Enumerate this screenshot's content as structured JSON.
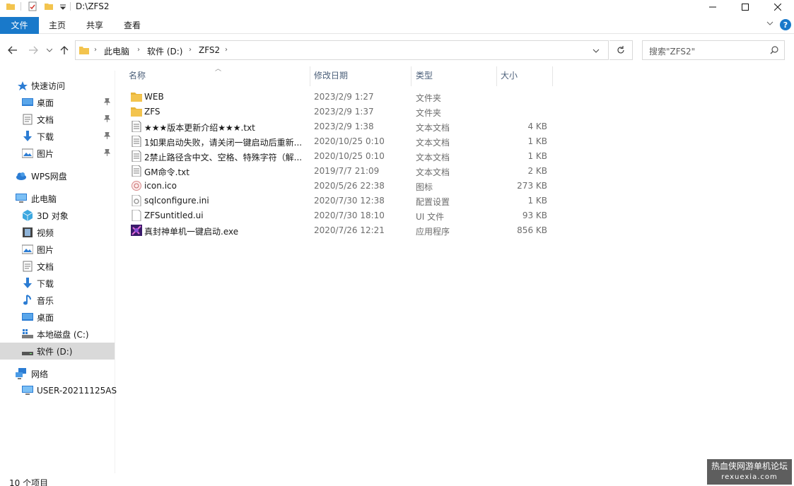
{
  "window": {
    "title": "D:\\ZFS2"
  },
  "ribbon": {
    "tabs": [
      "文件",
      "主页",
      "共享",
      "查看"
    ]
  },
  "address": {
    "parts": [
      "此电脑",
      "软件 (D:)",
      "ZFS2"
    ],
    "search_placeholder": "搜索\"ZFS2\""
  },
  "sidebar": {
    "items": [
      {
        "label": "快速访问",
        "icon": "star-icon",
        "level": 0
      },
      {
        "label": "桌面",
        "icon": "desktop-icon",
        "level": 1,
        "pinned": true
      },
      {
        "label": "文档",
        "icon": "document-icon",
        "level": 1,
        "pinned": true
      },
      {
        "label": "下载",
        "icon": "download-icon",
        "level": 1,
        "pinned": true
      },
      {
        "label": "图片",
        "icon": "picture-icon",
        "level": 1,
        "pinned": true
      },
      {
        "label": "WPS网盘",
        "icon": "cloud-icon",
        "level": 0
      },
      {
        "label": "此电脑",
        "icon": "computer-icon",
        "level": 0
      },
      {
        "label": "3D 对象",
        "icon": "3d-objects-icon",
        "level": 1
      },
      {
        "label": "视频",
        "icon": "video-icon",
        "level": 1
      },
      {
        "label": "图片",
        "icon": "picture-icon",
        "level": 1
      },
      {
        "label": "文档",
        "icon": "document-icon",
        "level": 1
      },
      {
        "label": "下载",
        "icon": "download-icon",
        "level": 1
      },
      {
        "label": "音乐",
        "icon": "music-icon",
        "level": 1
      },
      {
        "label": "桌面",
        "icon": "desktop-icon",
        "level": 1
      },
      {
        "label": "本地磁盘 (C:)",
        "icon": "drive-c-icon",
        "level": 1
      },
      {
        "label": "软件 (D:)",
        "icon": "drive-icon",
        "level": 1,
        "selected": true
      },
      {
        "label": "网络",
        "icon": "network-icon",
        "level": 0
      },
      {
        "label": "USER-20211125AS",
        "icon": "network-computer-icon",
        "level": 1
      }
    ]
  },
  "columns": [
    "名称",
    "修改日期",
    "类型",
    "大小"
  ],
  "files": [
    {
      "name": "WEB",
      "date": "2023/2/9 1:27",
      "type": "文件夹",
      "size": "",
      "icon": "folder-icon"
    },
    {
      "name": "ZFS",
      "date": "2023/2/9 1:37",
      "type": "文件夹",
      "size": "",
      "icon": "folder-icon"
    },
    {
      "name": "★★★版本更新介绍★★★.txt",
      "date": "2023/2/9 1:38",
      "type": "文本文档",
      "size": "4 KB",
      "icon": "text-file-icon"
    },
    {
      "name": "1如果启动失败，请关闭一键启动后重新...",
      "date": "2020/10/25 0:10",
      "type": "文本文档",
      "size": "1 KB",
      "icon": "text-file-icon"
    },
    {
      "name": "2禁止路径含中文、空格、特殊字符（解...",
      "date": "2020/10/25 0:10",
      "type": "文本文档",
      "size": "1 KB",
      "icon": "text-file-icon"
    },
    {
      "name": "GM命令.txt",
      "date": "2019/7/7 21:09",
      "type": "文本文档",
      "size": "2 KB",
      "icon": "text-file-icon"
    },
    {
      "name": "icon.ico",
      "date": "2020/5/26 22:38",
      "type": "图标",
      "size": "273 KB",
      "icon": "ico-file-icon"
    },
    {
      "name": "sqlconfigure.ini",
      "date": "2020/7/30 12:38",
      "type": "配置设置",
      "size": "1 KB",
      "icon": "settings-file-icon"
    },
    {
      "name": "ZFSuntitled.ui",
      "date": "2020/7/30 18:10",
      "type": "UI 文件",
      "size": "93 KB",
      "icon": "blank-file-icon"
    },
    {
      "name": "真封神单机一键启动.exe",
      "date": "2020/7/26 12:21",
      "type": "应用程序",
      "size": "856 KB",
      "icon": "exe-file-icon"
    }
  ],
  "status": {
    "count": "10 个项目"
  },
  "watermark": {
    "line1": "热血侠网游单机论坛",
    "line2": "rexuexia.com"
  },
  "colors": {
    "accent": "#1979ca",
    "folder": "#f3c44e",
    "selected": "#d9d9d9",
    "header_text": "#4c607a"
  }
}
